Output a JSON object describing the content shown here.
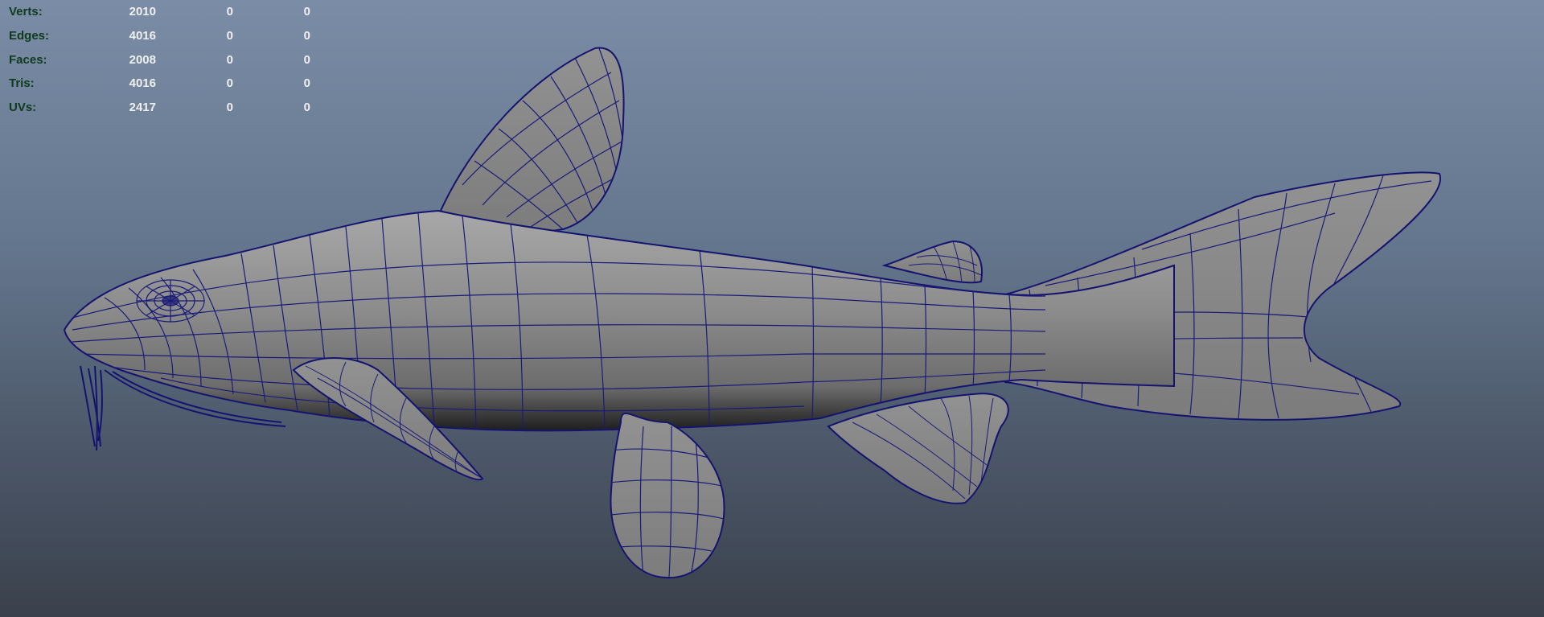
{
  "hud": {
    "rows": [
      {
        "label": "Verts:",
        "v1": "2010",
        "v2": "0",
        "v3": "0"
      },
      {
        "label": "Edges:",
        "v1": "4016",
        "v2": "0",
        "v3": "0"
      },
      {
        "label": "Faces:",
        "v1": "2008",
        "v2": "0",
        "v3": "0"
      },
      {
        "label": "Tris:",
        "v1": "4016",
        "v2": "0",
        "v3": "0"
      },
      {
        "label": "UVs:",
        "v1": "2417",
        "v2": "0",
        "v3": "0"
      }
    ]
  },
  "viewport": {
    "background_top": "#7b8da6",
    "background_bottom": "#3a414c",
    "mesh_fill": "#8a8a8a",
    "wire_color": "#1a1a7a"
  }
}
